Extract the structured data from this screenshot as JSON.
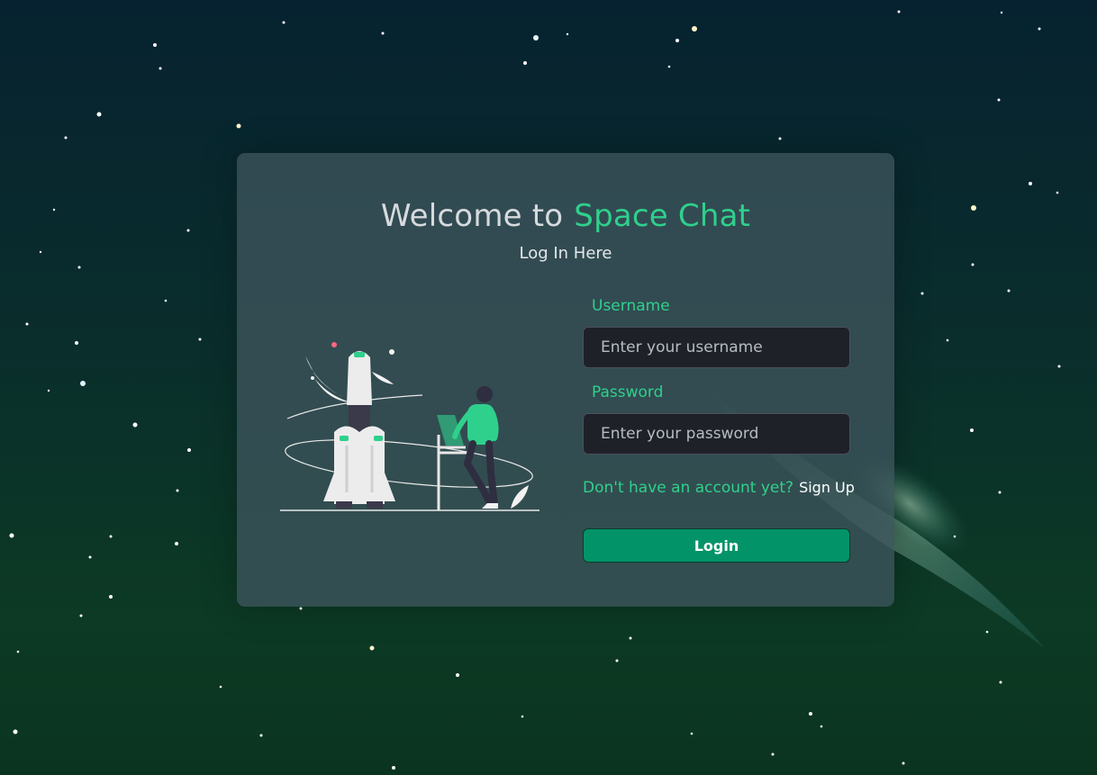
{
  "page": {
    "background_gradient": [
      "#062230",
      "#0a2e2c",
      "#0c3a24",
      "#0b3420"
    ]
  },
  "header": {
    "welcome_text": "Welcome to",
    "brand_name": "Space Chat",
    "subtitle": "Log In Here"
  },
  "form": {
    "username_label": "Username",
    "username_placeholder": "Enter your username",
    "password_label": "Password",
    "password_placeholder": "Enter your password",
    "signup_prompt": "Don't have an account yet?",
    "signup_link": "Sign Up",
    "login_button": "Login"
  },
  "colors": {
    "accent": "#2fd08c",
    "button": "#029468",
    "input_bg": "#1e2128",
    "card_bg": "rgba(62, 84, 92, 0.78)"
  },
  "illustration": {
    "icon": "rocket-launch-illustration"
  }
}
